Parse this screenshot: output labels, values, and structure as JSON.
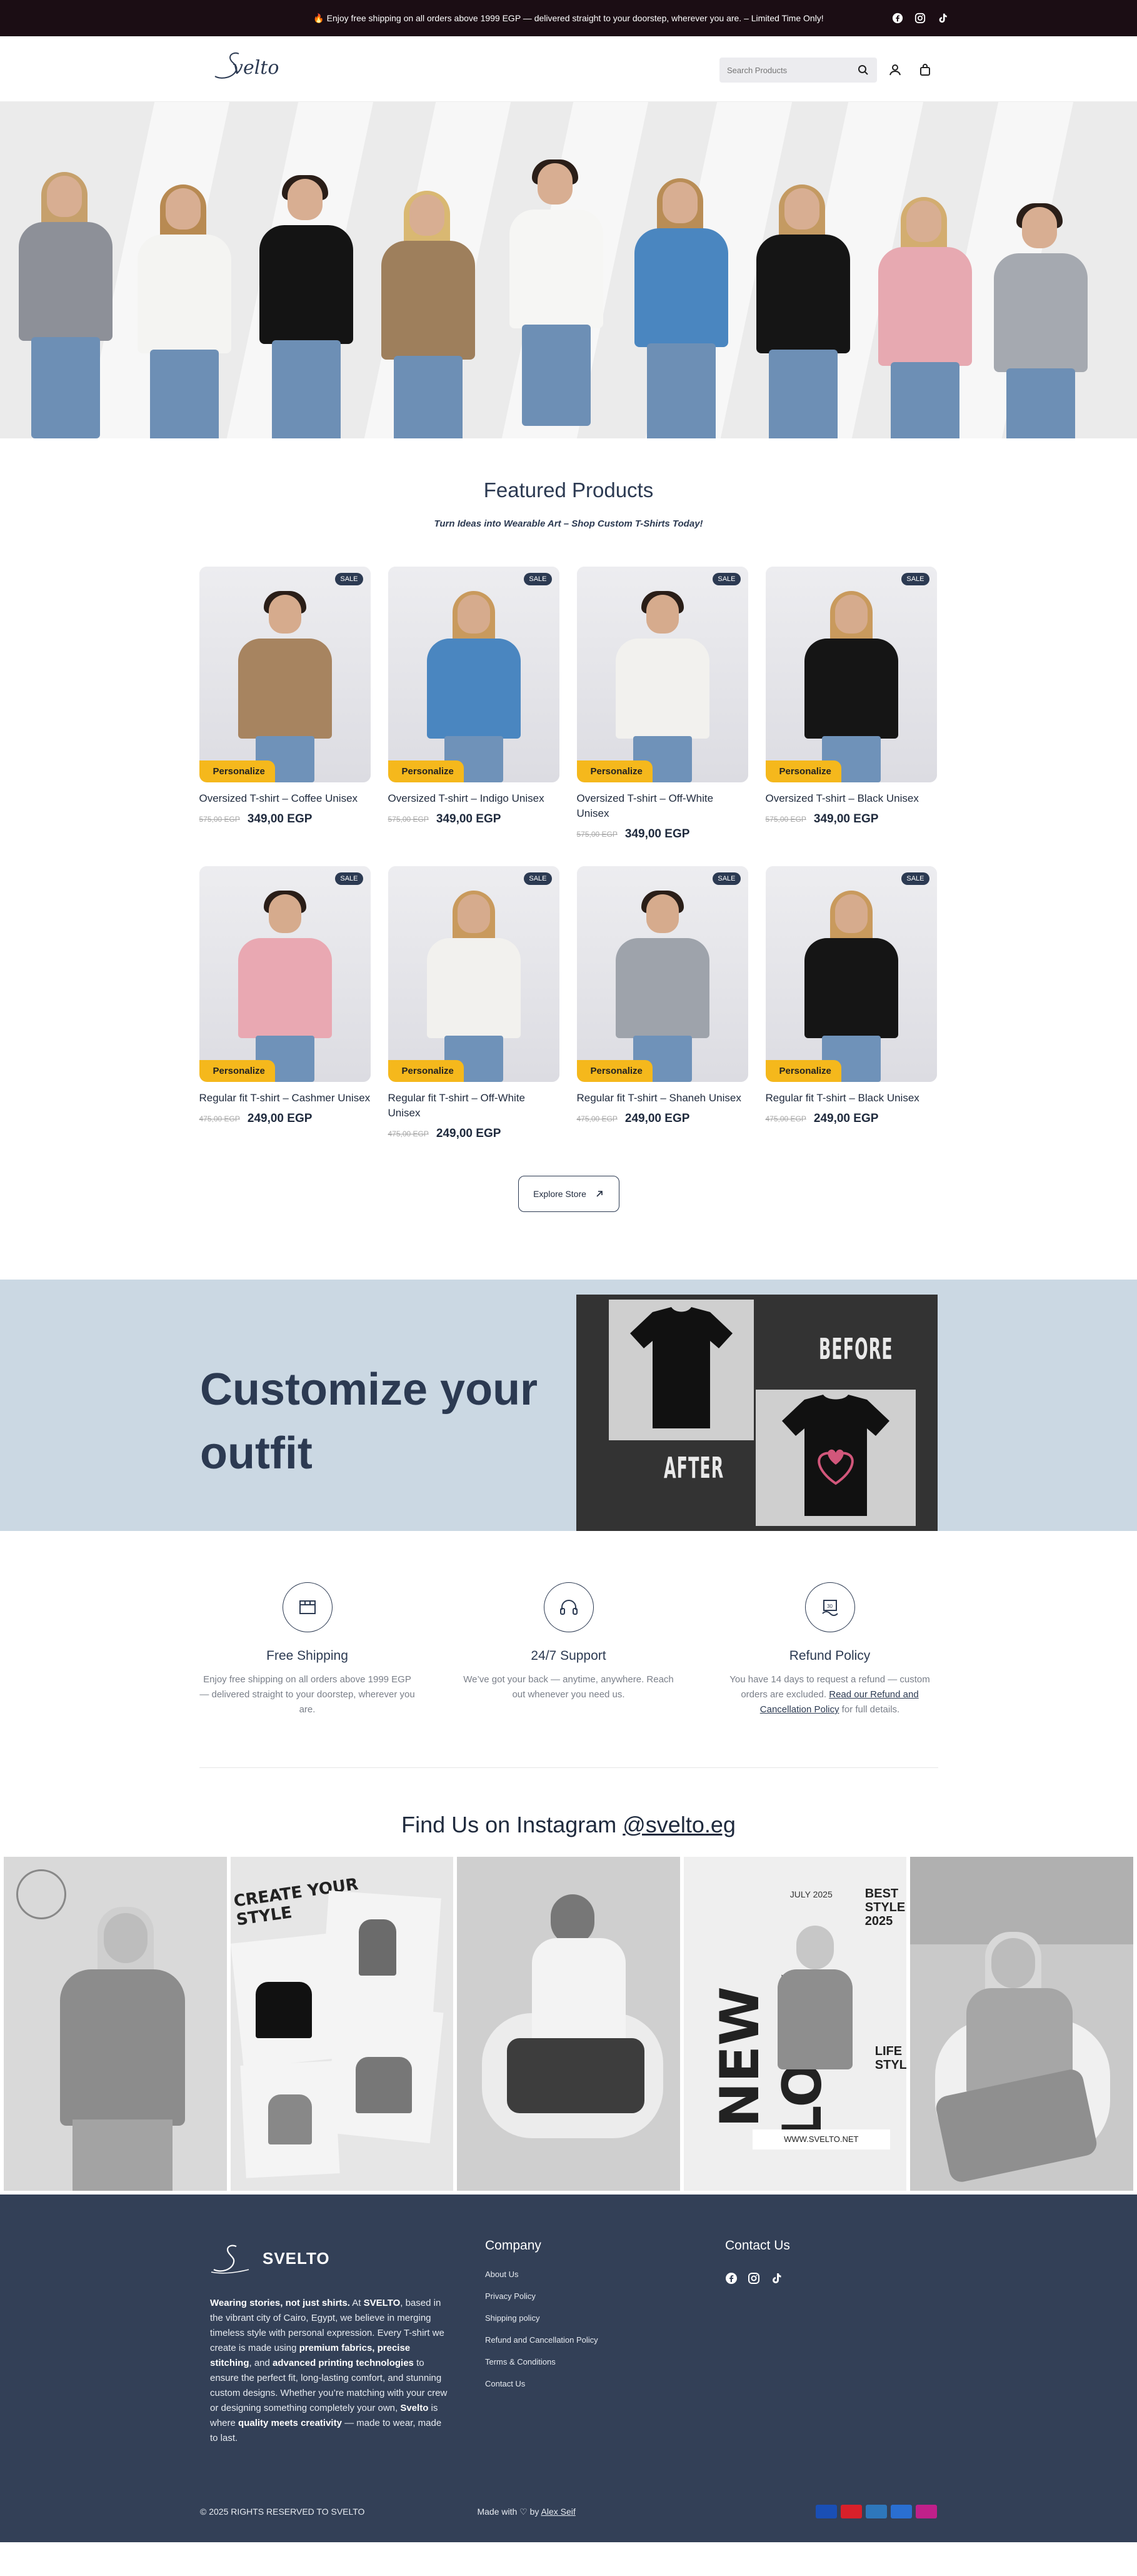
{
  "announcement": {
    "text": "🔥 Enjoy free shipping on all orders above 1999 EGP — delivered straight to your doorstep, wherever you are. – Limited Time Only!",
    "socials": [
      "facebook-icon",
      "instagram-icon",
      "tiktok-icon"
    ]
  },
  "header": {
    "logo": "Svelto",
    "search_placeholder": "Search Products"
  },
  "featured": {
    "title": "Featured Products",
    "subtitle": "Turn Ideas into Wearable Art – Shop Custom T-Shirts Today!",
    "sale_badge": "SALE",
    "personalize_label": "Personalize",
    "products": [
      {
        "name": "Oversized T-shirt – Coffee Unisex",
        "old_price": "575,00 EGP",
        "price": "349,00 EGP",
        "shirt": "#a78460",
        "gender": "m"
      },
      {
        "name": "Oversized T-shirt – Indigo Unisex",
        "old_price": "575,00 EGP",
        "price": "349,00 EGP",
        "shirt": "#4a86c0",
        "gender": "f"
      },
      {
        "name": "Oversized T-shirt – Off-White Unisex",
        "old_price": "575,00 EGP",
        "price": "349,00 EGP",
        "shirt": "#f2f1ee",
        "gender": "m"
      },
      {
        "name": "Oversized T-shirt – Black Unisex",
        "old_price": "575,00 EGP",
        "price": "349,00 EGP",
        "shirt": "#151515",
        "gender": "f"
      },
      {
        "name": "Regular fit T-shirt – Cashmer Unisex",
        "old_price": "475,00 EGP",
        "price": "249,00 EGP",
        "shirt": "#e9a8b2",
        "gender": "m"
      },
      {
        "name": "Regular fit T-shirt – Off-White Unisex",
        "old_price": "475,00 EGP",
        "price": "249,00 EGP",
        "shirt": "#f2f1ee",
        "gender": "f"
      },
      {
        "name": "Regular fit T-shirt – Shaneh Unisex",
        "old_price": "475,00 EGP",
        "price": "249,00 EGP",
        "shirt": "#9ea3ab",
        "gender": "m"
      },
      {
        "name": "Regular fit T-shirt – Black Unisex",
        "old_price": "475,00 EGP",
        "price": "249,00 EGP",
        "shirt": "#151515",
        "gender": "f"
      }
    ],
    "explore_label": "Explore Store"
  },
  "customize": {
    "heading": "Customize your outfit",
    "before_label": "BEFORE",
    "after_label": "AFTER"
  },
  "features": [
    {
      "title": "Free Shipping",
      "desc": "Enjoy free shipping on all orders above 1999 EGP — delivered straight to your doorstep, wherever you are.",
      "icon": "shipping-box-icon"
    },
    {
      "title": "24/7 Support",
      "desc": "We’ve got your back — anytime, anywhere. Reach out whenever you need us.",
      "icon": "headset-icon"
    },
    {
      "title": "Refund Policy",
      "desc": "You have 14 days to request a refund — custom orders are excluded.",
      "link": "Read our Refund and Cancellation Policy",
      "desc_end": " for full details.",
      "icon": "refund-icon"
    }
  ],
  "instagram": {
    "title": "Find Us on Instagram",
    "handle": "@svelto.eg",
    "tiles": [
      {
        "name": "ig-post-woman-tee"
      },
      {
        "name": "ig-post-create-your-style",
        "text": "CREATE YOUR STYLE"
      },
      {
        "name": "ig-post-man-sitting"
      },
      {
        "name": "ig-post-new-look",
        "text": "NEW LOOK",
        "date": "JULY 2025",
        "best": "BEST STYLE 2025",
        "life": "LIFE STYL",
        "url": "WWW.SVELTO.NET"
      },
      {
        "name": "ig-post-woman-chair"
      }
    ]
  },
  "footer": {
    "brand": "SVELTO",
    "about_lead": "Wearing stories, not just shirts.",
    "about_1": " At ",
    "about_brand": "SVELTO",
    "about_2": ", based in the vibrant city of Cairo, Egypt, we believe in merging timeless style with personal expression. Every T-shirt we create is made using ",
    "about_b1": "premium fabrics, precise stitching",
    "about_3": ", and ",
    "about_b2": "advanced printing technologies",
    "about_4": " to ensure the perfect fit, long-lasting comfort, and stunning custom designs. Whether you’re matching with your crew or designing something completely your own, ",
    "about_b3": "Svelto",
    "about_5": " is where ",
    "about_b4": "quality meets creativity",
    "about_6": " — made to wear, made to last.",
    "company_title": "Company",
    "company_links": [
      "About Us",
      "Privacy Policy",
      "Shipping policy",
      "Refund and Cancellation Policy",
      "Terms & Conditions",
      "Contact Us"
    ],
    "contact_title": "Contact Us",
    "copyright": "© 2025 RIGHTS RESERVED TO SVELTO",
    "made_with": "Made with ♡ by ",
    "author": "Alex Seif",
    "payments": [
      {
        "name": "visa-icon",
        "color": "#1a4fb5"
      },
      {
        "name": "mastercard-icon",
        "color": "#d8202a"
      },
      {
        "name": "amex-icon",
        "color": "#2e77bb"
      },
      {
        "name": "paypal-icon",
        "color": "#2a6fd1"
      },
      {
        "name": "instapay-icon",
        "color": "#c0208a"
      }
    ]
  }
}
